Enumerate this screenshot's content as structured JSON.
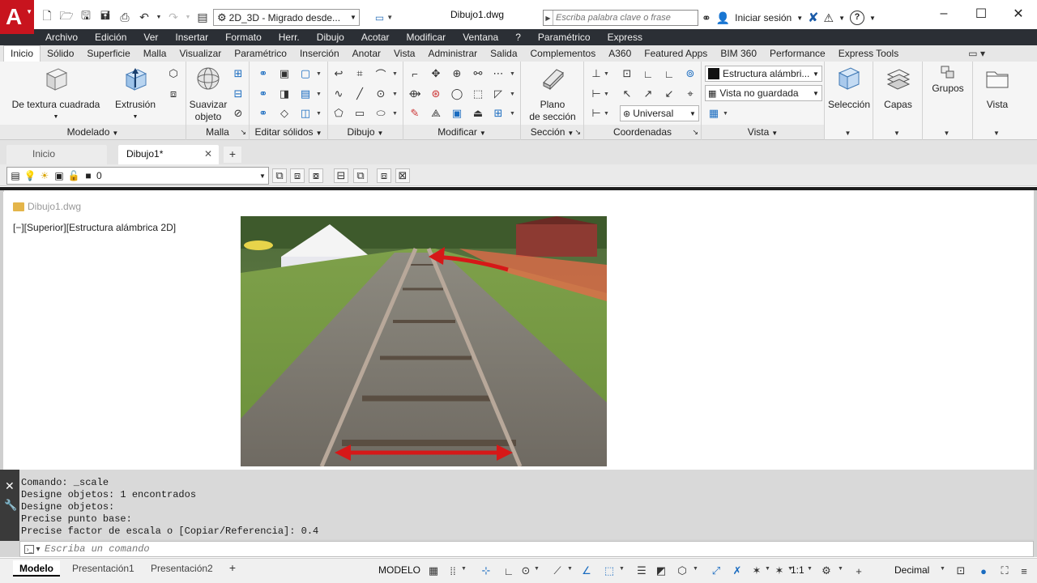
{
  "title_bar": {
    "app_logo_letter": "A",
    "workspace": "2D_3D - Migrado desde...",
    "document_title": "Dibujo1.dwg",
    "search_placeholder": "Escriba palabra clave o frase",
    "login_label": "Iniciar sesión",
    "minimize": "–",
    "maximize": "☐",
    "close": "✕"
  },
  "menu_bar": [
    "Archivo",
    "Edición",
    "Ver",
    "Insertar",
    "Formato",
    "Herr.",
    "Dibujo",
    "Acotar",
    "Modificar",
    "Ventana",
    "?",
    "Paramétrico",
    "Express"
  ],
  "ribbon_tabs": [
    "Inicio",
    "Sólido",
    "Superficie",
    "Malla",
    "Visualizar",
    "Paramétrico",
    "Inserción",
    "Anotar",
    "Vista",
    "Administrar",
    "Salida",
    "Complementos",
    "A360",
    "Featured Apps",
    "BIM 360",
    "Performance",
    "Express Tools"
  ],
  "ribbon": {
    "modelado": {
      "title": "Modelado",
      "box_label": "De textura cuadrada",
      "extrusion_label": "Extrusión"
    },
    "malla": {
      "title": "Malla",
      "smooth_label_1": "Suavizar",
      "smooth_label_2": "objeto"
    },
    "editar_solidos": {
      "title": "Editar sólidos"
    },
    "dibujo": {
      "title": "Dibujo"
    },
    "modificar": {
      "title": "Modificar"
    },
    "seccion": {
      "title": "Sección",
      "plane_label_1": "Plano",
      "plane_label_2": "de sección"
    },
    "coordenadas": {
      "title": "Coordenadas",
      "ucs_value": "Universal"
    },
    "vista": {
      "title": "Vista",
      "visual_style": "Estructura alámbri...",
      "named_view": "Vista no guardada"
    },
    "seleccion_label": "Selección",
    "capas_label": "Capas",
    "grupos_label": "Grupos",
    "vista_label": "Vista"
  },
  "file_tabs": {
    "start": "Inicio",
    "drawing": "Dibujo1*",
    "close": "✕",
    "add": "+"
  },
  "layer_bar": {
    "current_layer": "0"
  },
  "drawing_area": {
    "file_label": "Dibujo1.dwg",
    "viewport_label": "[−][Superior][Estructura alámbrica 2D]"
  },
  "command_line": {
    "history": [
      "Comando: _scale",
      "Designe objetos: 1 encontrados",
      "Designe objetos:",
      "Precise punto base:",
      "Precise factor de escala o [Copiar/Referencia]: 0.4"
    ],
    "input_placeholder": "Escriba un comando"
  },
  "status_bar": {
    "layout_tabs": [
      "Modelo",
      "Presentación1",
      "Presentación2"
    ],
    "add_tab": "+",
    "model_label": "MODELO",
    "scale": "1:1",
    "units": "Decimal"
  },
  "colors": {
    "logo_red": "#c8141e",
    "menu_dark": "#2b2f35",
    "command_bg": "#d9d9d9"
  }
}
